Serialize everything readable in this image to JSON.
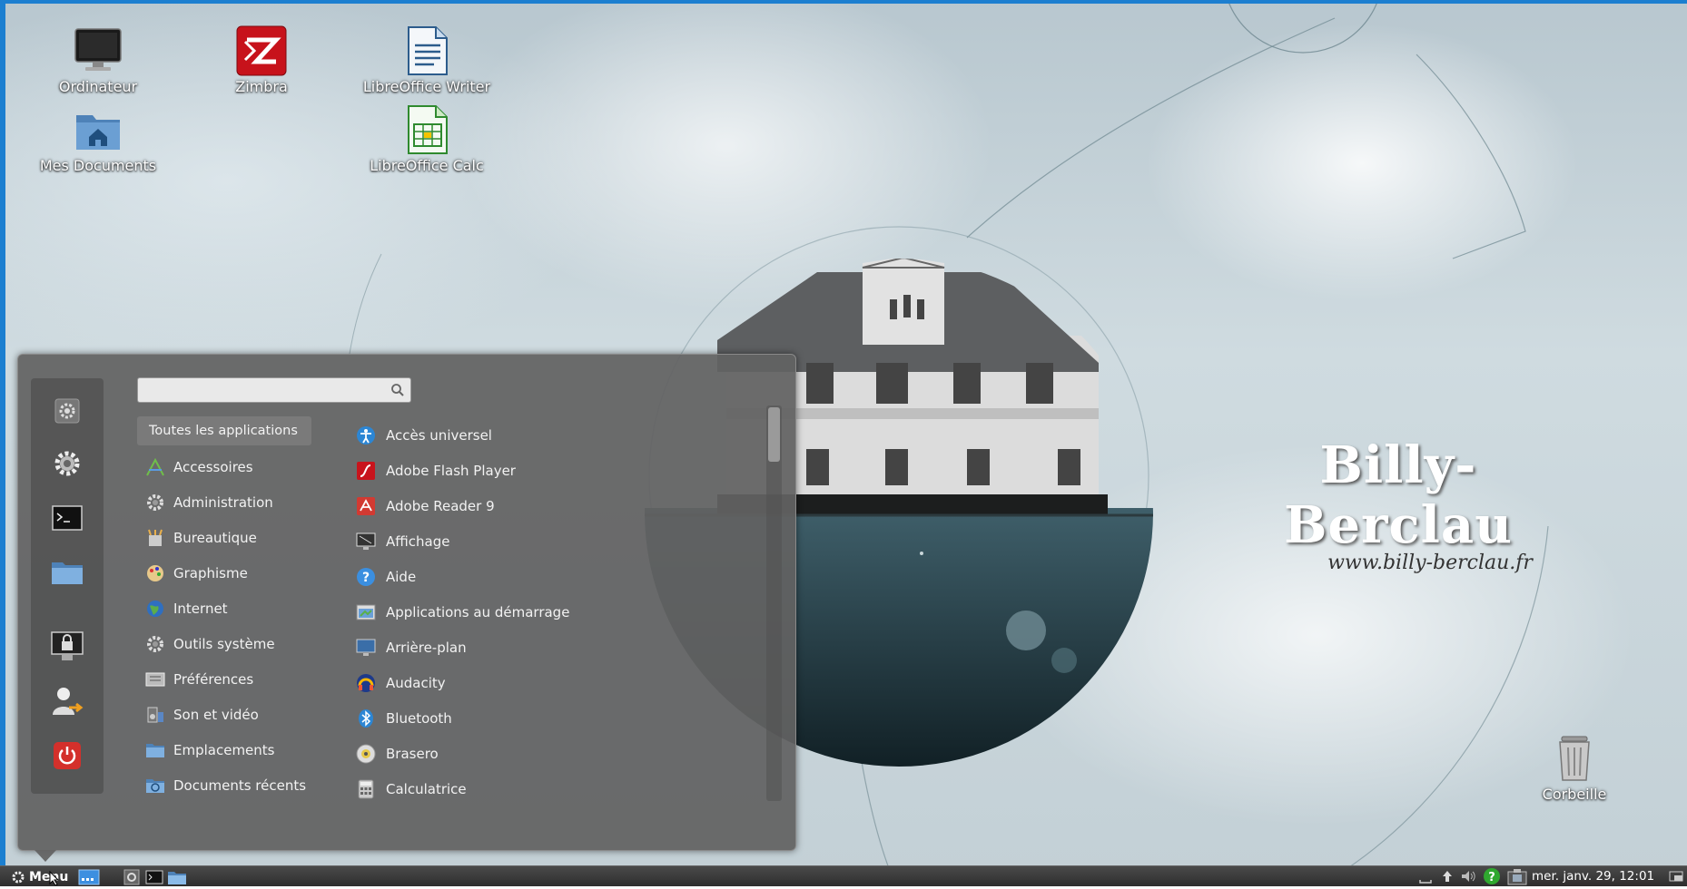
{
  "desktop": {
    "icons": [
      {
        "name": "Ordinateur"
      },
      {
        "name": "Zimbra"
      },
      {
        "name": "LibreOffice Writer"
      },
      {
        "name": "Mes Documents"
      },
      {
        "name": "LibreOffice Calc"
      },
      {
        "name": "Corbeille"
      }
    ],
    "brand": {
      "title": "Billy-Berclau",
      "url": "www.billy-berclau.fr"
    }
  },
  "menu": {
    "search": {
      "value": "",
      "placeholder": ""
    },
    "favorites": [
      "settings-small-icon",
      "gear-icon",
      "terminal-icon",
      "folder-icon",
      "lock-screen-icon",
      "logout-user-icon",
      "power-icon"
    ],
    "categories": [
      {
        "label": "Toutes les applications",
        "selected": true
      },
      {
        "label": "Accessoires"
      },
      {
        "label": "Administration"
      },
      {
        "label": "Bureautique"
      },
      {
        "label": "Graphisme"
      },
      {
        "label": "Internet"
      },
      {
        "label": "Outils système"
      },
      {
        "label": "Préférences"
      },
      {
        "label": "Son et vidéo"
      },
      {
        "label": "Emplacements"
      },
      {
        "label": "Documents récents"
      }
    ],
    "applications": [
      {
        "label": "Accès universel"
      },
      {
        "label": "Adobe Flash Player"
      },
      {
        "label": "Adobe Reader 9"
      },
      {
        "label": "Affichage"
      },
      {
        "label": "Aide"
      },
      {
        "label": "Applications au démarrage"
      },
      {
        "label": "Arrière-plan"
      },
      {
        "label": "Audacity"
      },
      {
        "label": "Bluetooth"
      },
      {
        "label": "Brasero"
      },
      {
        "label": "Calculatrice"
      }
    ]
  },
  "panel": {
    "menu_label": "Menu",
    "clock": "mer. janv. 29, 12:01"
  },
  "colors": {
    "accent": "#1c7fd0",
    "menu_bg": "#626262",
    "panel_bg": "#333333"
  }
}
